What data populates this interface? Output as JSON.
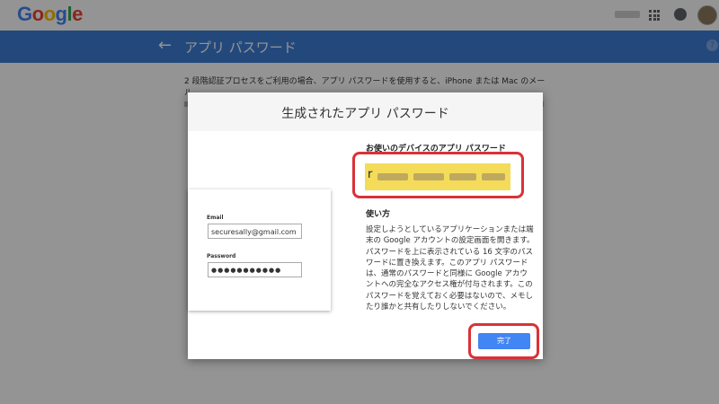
{
  "header": {
    "logo_text": "Google",
    "logo_colors": [
      "#4285F4",
      "#EA4335",
      "#FBBC05",
      "#4285F4",
      "#34A853",
      "#EA4335"
    ],
    "icons": [
      "apps-icon",
      "notifications-icon",
      "avatar"
    ]
  },
  "page": {
    "title": "アプリ パスワード",
    "back_icon": "arrow-left-icon",
    "help_icon": "help-icon",
    "help_glyph": "?",
    "bg_text_line1": "2 段階認証プロセスをご利用の場合、アプリ パスワードを使用すると、iPhone または Mac のメール、"
  },
  "dialog": {
    "title": "生成されたアプリ パスワード",
    "illustration": {
      "email_label": "Email",
      "email_value": "securesally@gmail.com",
      "password_label": "Password",
      "password_value": "●●●●●●●●●●●"
    },
    "password_section_label": "お使いのデバイスのアプリ パスワード",
    "password_visible_char": "r",
    "usage_heading": "使い方",
    "usage_text": "設定しようとしているアプリケーションまたは端末の Google アカウントの設定画面を開きます。パスワードを上に表示されている 16 文字のパスワードに置き換えます。このアプリ パスワードは、通常のパスワードと同様に Google アカウントへの完全なアクセス権が付与されます。このパスワードを覚えておく必要はないので、メモしたり誰かと共有したりしないでください。",
    "done_label": "完了"
  },
  "colors": {
    "blue_bar": "#3d7fd6",
    "highlight_red": "#d93239",
    "password_highlight": "#f4dc5a",
    "done_button": "#4285f4"
  }
}
